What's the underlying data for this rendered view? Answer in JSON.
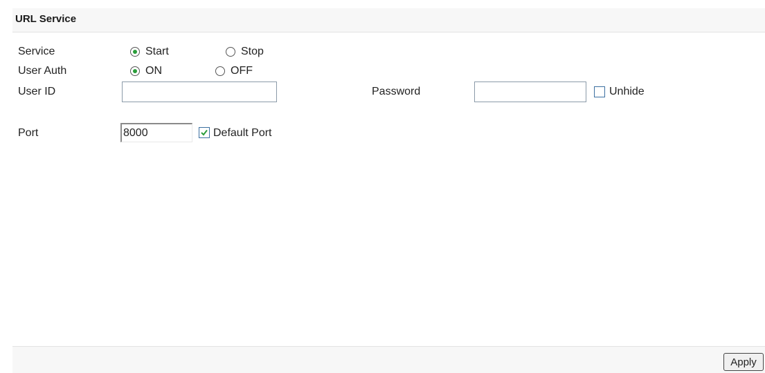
{
  "panel": {
    "title": "URL Service"
  },
  "service": {
    "label": "Service",
    "options": [
      {
        "label": "Start",
        "checked": true
      },
      {
        "label": "Stop",
        "checked": false
      }
    ]
  },
  "user_auth": {
    "label": "User Auth",
    "options": [
      {
        "label": "ON",
        "checked": true
      },
      {
        "label": "OFF",
        "checked": false
      }
    ]
  },
  "user_id": {
    "label": "User ID",
    "value": ""
  },
  "password": {
    "label": "Password",
    "value": "",
    "unhide_label": "Unhide",
    "unhide_checked": false
  },
  "port": {
    "label": "Port",
    "value": "8000",
    "default_label": "Default Port",
    "default_checked": true
  },
  "footer": {
    "apply_label": "Apply"
  },
  "colors": {
    "radio_dot": "#2a9d3a",
    "checkmark": "#2a9d3a",
    "header_bg": "#f7f7f7"
  }
}
